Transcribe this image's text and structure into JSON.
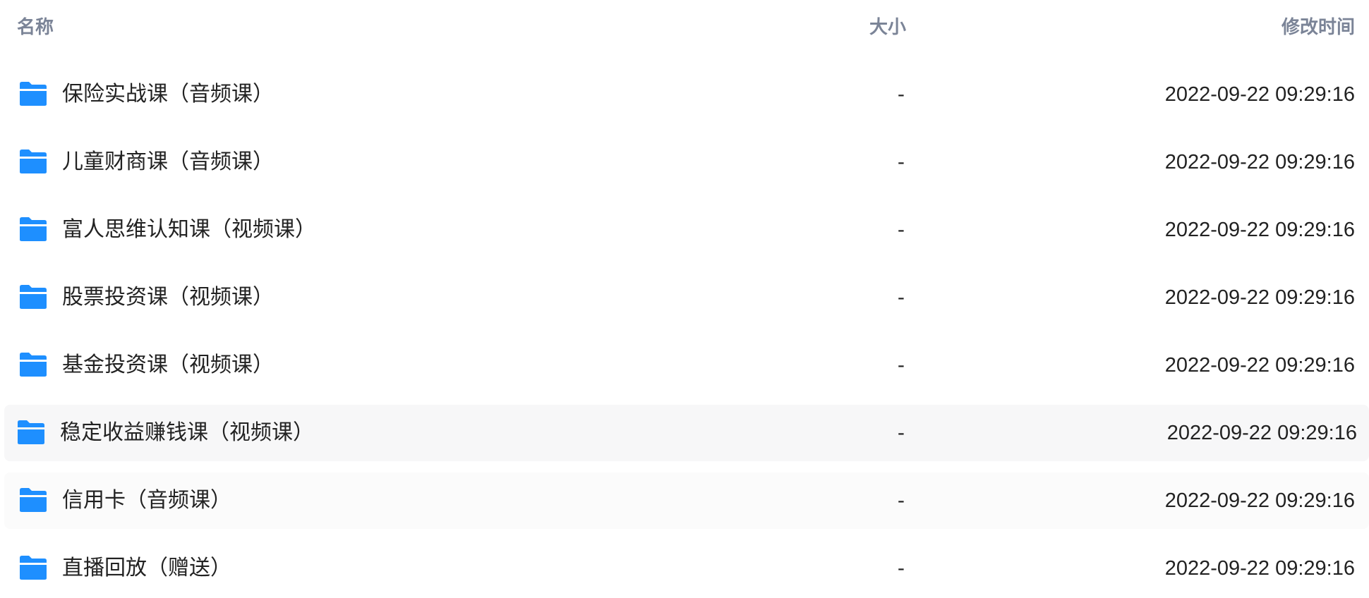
{
  "columns": {
    "name": "名称",
    "size": "大小",
    "modified": "修改时间"
  },
  "folder_icon_color": "#1e8fff",
  "files": [
    {
      "icon": "folder-icon",
      "name": "保险实战课（音频课）",
      "size": "-",
      "modified": "2022-09-22 09:29:16"
    },
    {
      "icon": "folder-icon",
      "name": "儿童财商课（音频课）",
      "size": "-",
      "modified": "2022-09-22 09:29:16"
    },
    {
      "icon": "folder-icon",
      "name": "富人思维认知课（视频课）",
      "size": "-",
      "modified": "2022-09-22 09:29:16"
    },
    {
      "icon": "folder-icon",
      "name": "股票投资课（视频课）",
      "size": "-",
      "modified": "2022-09-22 09:29:16"
    },
    {
      "icon": "folder-icon",
      "name": "基金投资课（视频课）",
      "size": "-",
      "modified": "2022-09-22 09:29:16"
    },
    {
      "icon": "folder-icon",
      "name": "稳定收益赚钱课（视频课）",
      "size": "-",
      "modified": "2022-09-22 09:29:16"
    },
    {
      "icon": "folder-icon",
      "name": "信用卡（音频课）",
      "size": "-",
      "modified": "2022-09-22 09:29:16"
    },
    {
      "icon": "folder-icon",
      "name": "直播回放（赠送）",
      "size": "-",
      "modified": "2022-09-22 09:29:16"
    }
  ]
}
